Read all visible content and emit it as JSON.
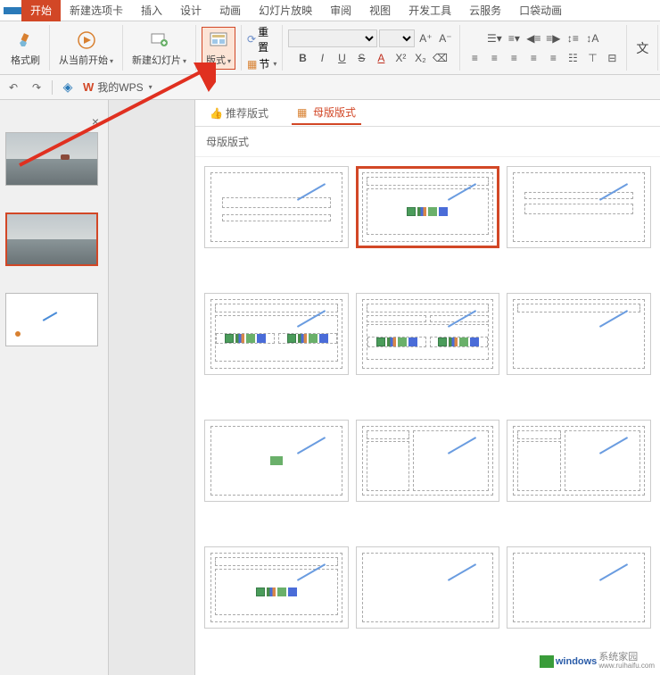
{
  "ribbon": {
    "tabs": [
      "开始",
      "新建选项卡",
      "插入",
      "设计",
      "动画",
      "幻灯片放映",
      "审阅",
      "视图",
      "开发工具",
      "云服务",
      "口袋动画"
    ],
    "active": 0
  },
  "toolbar": {
    "format_painter": "格式刷",
    "from_current": "从当前开始",
    "new_slide": "新建幻灯片",
    "layout": "版式",
    "reset": "重置",
    "section": "节",
    "font_ops": {
      "bold": "B",
      "italic": "I",
      "underline": "U",
      "strike": "S",
      "fontcolor": "A"
    },
    "text_group_label": "文"
  },
  "quick_access": {
    "wps_label": "我的WPS"
  },
  "layout_panel": {
    "tab_recommend": "推荐版式",
    "tab_master": "母版版式",
    "section_title": "母版版式",
    "active_tab": 1,
    "selected_index": 1
  },
  "watermark": {
    "brand": "windows",
    "suffix": "系统家园",
    "url": "www.ruihaifu.com"
  }
}
